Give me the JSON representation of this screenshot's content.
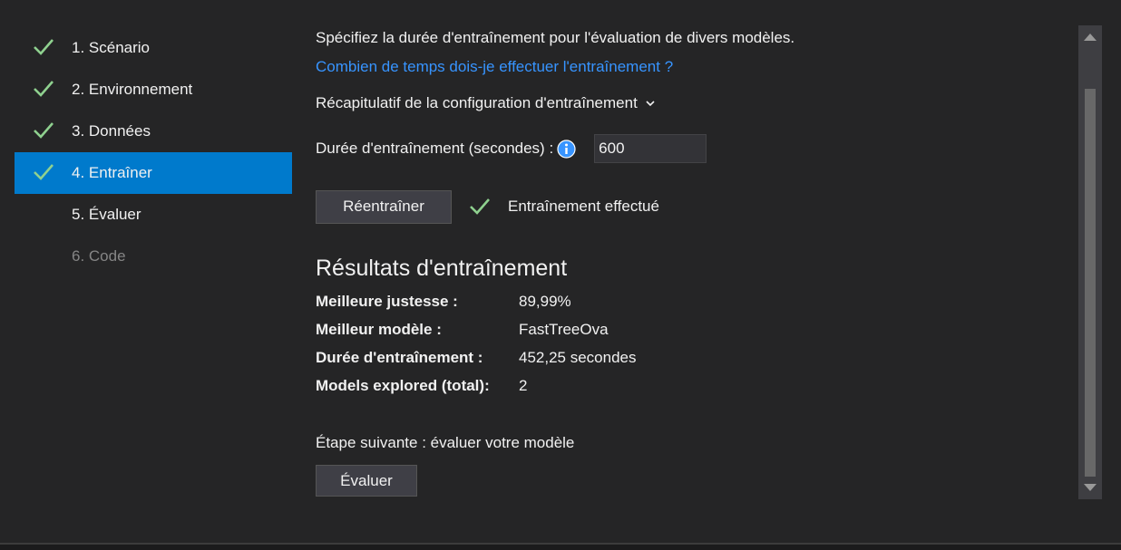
{
  "sidebar": {
    "steps": [
      {
        "label": "1. Scénario",
        "checked": true
      },
      {
        "label": "2. Environnement",
        "checked": true
      },
      {
        "label": "3. Données",
        "checked": true
      },
      {
        "label": "4. Entraîner",
        "checked": true,
        "active": true
      },
      {
        "label": "5. Évaluer",
        "checked": false
      },
      {
        "label": "6. Code",
        "checked": false,
        "disabled": true
      }
    ]
  },
  "main": {
    "description": "Spécifiez la durée d'entraînement pour l'évaluation de divers modèles.",
    "help_link": "Combien de temps dois-je effectuer l'entraînement ?",
    "summary_label": "Récapitulatif de la configuration d'entraînement",
    "duration_label": "Durée d'entraînement (secondes) :",
    "duration_value": "600",
    "retrain_button": "Réentraîner",
    "status_label": "Entraînement effectué",
    "results_title": "Résultats d'entraînement",
    "results": [
      {
        "key": "Meilleure justesse :",
        "value": "89,99%"
      },
      {
        "key": "Meilleur modèle :",
        "value": "FastTreeOva"
      },
      {
        "key": "Durée d'entraînement :",
        "value": "452,25 secondes"
      },
      {
        "key": "Models explored (total):",
        "value": "2"
      }
    ],
    "next_step": "Étape suivante : évaluer votre modèle",
    "evaluate_button": "Évaluer"
  },
  "colors": {
    "background": "#252526",
    "active_step": "#007acc",
    "link": "#3794ff",
    "check": "#8fd18f",
    "info_icon": "#3794ff"
  },
  "icons": {
    "check": "check-icon",
    "info": "info-icon",
    "chevron": "chevron-down-icon"
  }
}
